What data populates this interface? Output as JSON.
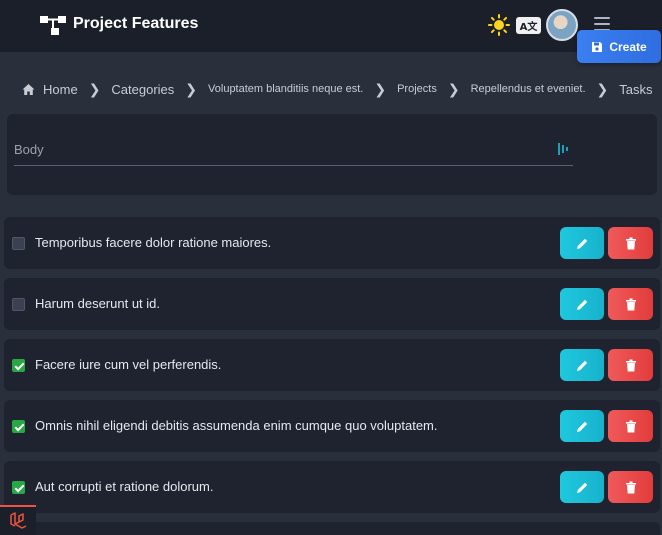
{
  "app": {
    "title": "Project Features",
    "lang_badge": "A文"
  },
  "breadcrumb": {
    "items": [
      "Home",
      "Categories",
      "Voluptatem blanditiis neque est.",
      "Projects",
      "Repellendus et eveniet.",
      "Tasks"
    ]
  },
  "form": {
    "placeholder": "Body",
    "value": "",
    "create_label": "Create"
  },
  "tasks": [
    {
      "text": "Temporibus facere dolor ratione maiores.",
      "done": false
    },
    {
      "text": "Harum deserunt ut id.",
      "done": false
    },
    {
      "text": "Facere iure cum vel perferendis.",
      "done": true
    },
    {
      "text": "Omnis nihil eligendi debitis assumenda enim cumque quo voluptatem.",
      "done": true
    },
    {
      "text": "Aut corrupti et ratione dolorum.",
      "done": true
    }
  ],
  "icons": {
    "logo": "project-hierarchy-icon",
    "theme": "sun-icon",
    "lang": "translate-icon",
    "menu": "hamburger-menu-icon",
    "home": "home-icon",
    "save": "floppy-disk-icon",
    "edit": "pencil-icon",
    "delete": "trash-icon",
    "framework": "laravel-icon"
  },
  "colors": {
    "accent": "#2f6de0",
    "edit": "#1fc8de",
    "delete": "#e23c3c",
    "checked": "#28a745"
  }
}
